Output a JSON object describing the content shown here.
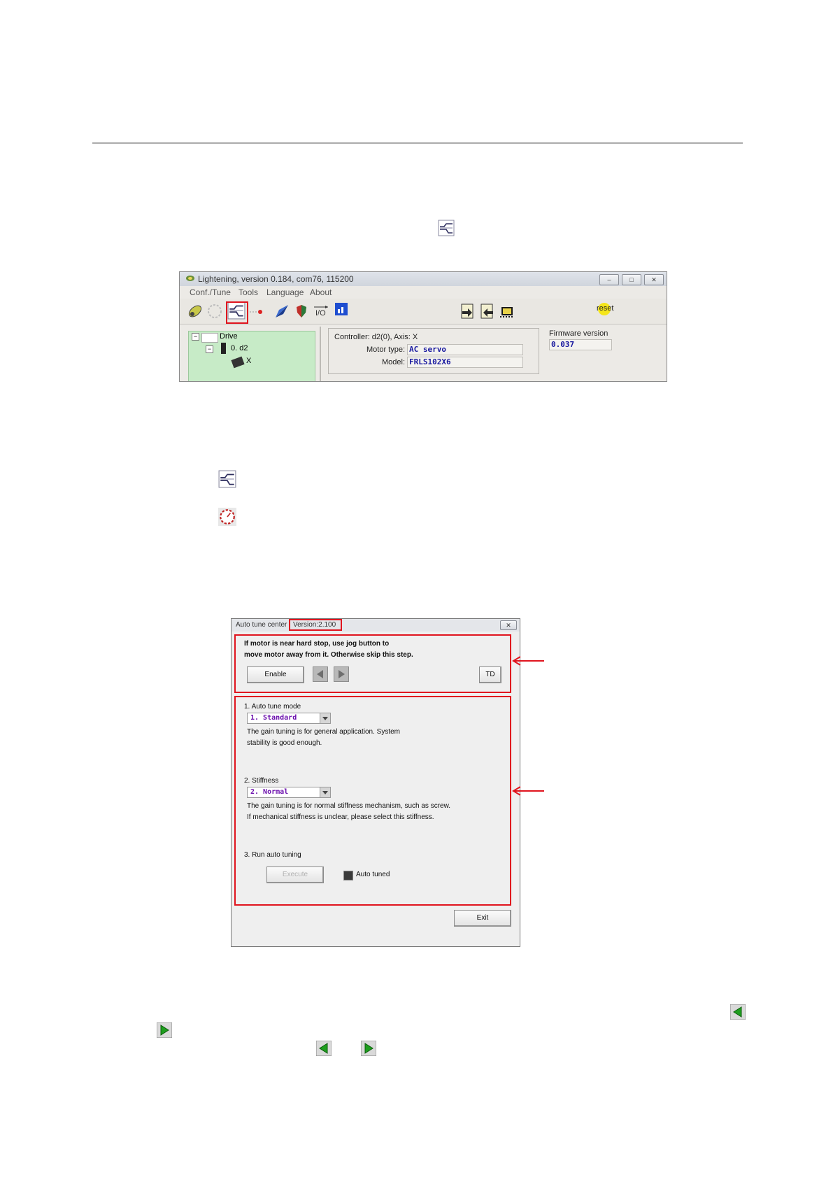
{
  "main_window": {
    "title": "Lightening, version 0.184, com76, 115200",
    "menu": [
      "Conf./Tune",
      "Tools",
      "Language",
      "About"
    ],
    "toolbar_icons": [
      "connect-icon",
      "settings-icon",
      "auto-tune-icon",
      "stop-motion-icon",
      "scope-icon",
      "protection-icon",
      "io-icon",
      "signal-icon",
      "save-icon",
      "load-icon",
      "chip-icon"
    ],
    "io_label": "I/O",
    "reset_label": "reset",
    "tree": {
      "root": "Drive",
      "node": "0. d2",
      "leaf": "X"
    },
    "controller_label": "Controller: d2(0),  Axis: X",
    "motor_type_label": "Motor type:",
    "motor_type_value": "AC servo",
    "model_label": "Model:",
    "model_value": "FRLS102X6",
    "firmware_label": "Firmware version",
    "firmware_value": "0.037"
  },
  "auto_tune_dialog": {
    "title": "Auto tune center",
    "version": "Version:2.100",
    "step0_text_line1": "If motor is near hard stop, use jog button to",
    "step0_text_line2": "move motor away from it. Otherwise skip this step.",
    "enable_label": "Enable",
    "td_label": "TD",
    "mode_heading": "1. Auto tune mode",
    "mode_value": "1. Standard",
    "mode_desc_line1": "The gain tuning is for general application. System",
    "mode_desc_line2": "stability is good enough.",
    "stiffness_heading": "2. Stiffness",
    "stiffness_value": "2. Normal",
    "stiffness_desc_line1": "The gain tuning is for normal stiffness mechanism, such as screw.",
    "stiffness_desc_line2": "If mechanical stiffness is unclear, please select this stiffness.",
    "run_heading": "3. Run auto tuning",
    "execute_label": "Execute",
    "auto_tuned_label": "Auto tuned",
    "exit_label": "Exit"
  },
  "colors": {
    "highlight_red": "#e0141e",
    "tree_green": "#c7ebc7",
    "jog_green": "#1e9e1e"
  }
}
